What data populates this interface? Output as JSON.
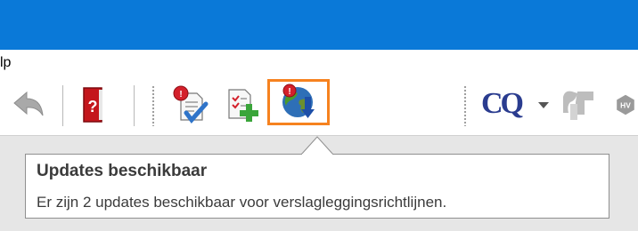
{
  "window": {
    "titlebar_color": "#0a79d8"
  },
  "menubar": {
    "items": [
      {
        "label": "lp"
      }
    ]
  },
  "toolbar": {
    "buttons": [
      {
        "icon": "back-arrow-icon",
        "enabled": false
      },
      {
        "icon": "help-book-icon"
      },
      {
        "icon": "validate-document-icon"
      },
      {
        "icon": "add-document-icon"
      },
      {
        "icon": "globe-update-icon",
        "highlighted": true,
        "highlight_color": "#f6821f"
      },
      {
        "icon": "cq-logo-icon",
        "label": "CQ"
      },
      {
        "icon": "dropdown-arrow-icon"
      },
      {
        "icon": "xbrl-logo-icon"
      },
      {
        "icon": "hv-badge-icon",
        "label": "HV"
      }
    ]
  },
  "tooltip": {
    "title": "Updates beschikbaar",
    "body": "Er zijn 2 updates beschikbaar voor verslagleggingsrichtlijnen."
  }
}
